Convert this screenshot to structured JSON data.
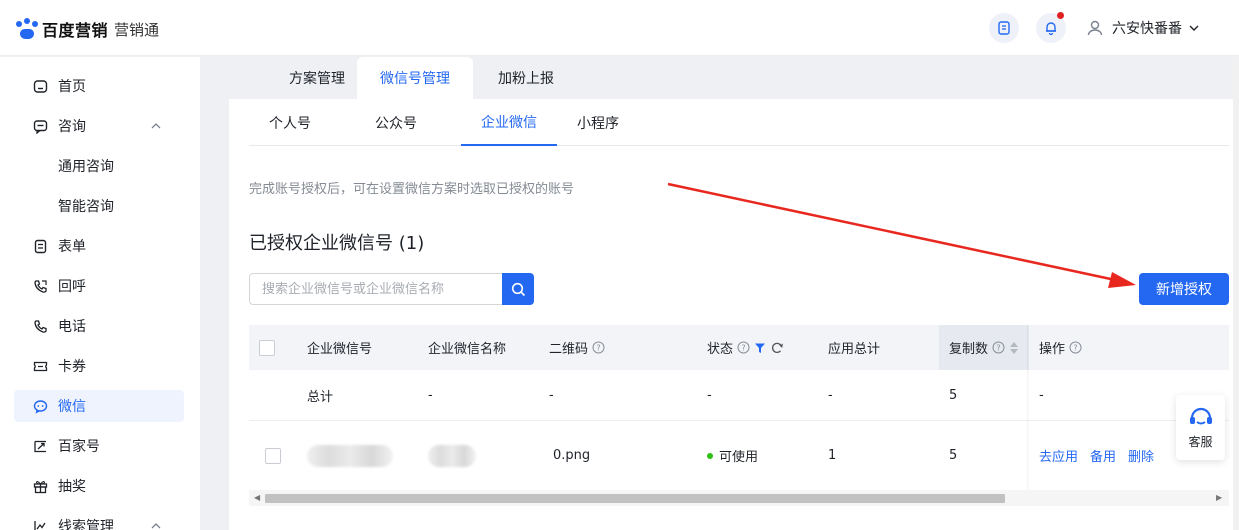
{
  "header": {
    "brand": "百度营销",
    "product": "营销通",
    "user_name": "六安快番番"
  },
  "sidebar": {
    "items": [
      {
        "label": "首页",
        "icon": "home-icon"
      },
      {
        "label": "咨询",
        "icon": "chat-icon",
        "expanded": true
      },
      {
        "label": "通用咨询"
      },
      {
        "label": "智能咨询"
      },
      {
        "label": "表单",
        "icon": "form-icon"
      },
      {
        "label": "回呼",
        "icon": "callback-icon"
      },
      {
        "label": "电话",
        "icon": "phone-icon"
      },
      {
        "label": "卡券",
        "icon": "ticket-icon"
      },
      {
        "label": "微信",
        "icon": "wechat-icon",
        "active": true
      },
      {
        "label": "百家号",
        "icon": "baijiahao-icon"
      },
      {
        "label": "抽奖",
        "icon": "gift-icon"
      },
      {
        "label": "线索管理",
        "icon": "chart-icon",
        "expanded": true
      }
    ]
  },
  "top_tabs": [
    "方案管理",
    "微信号管理",
    "加粉上报"
  ],
  "sub_tabs": [
    "个人号",
    "公众号",
    "企业微信",
    "小程序"
  ],
  "hint": "完成账号授权后，可在设置微信方案时选取已授权的账号",
  "section_title": "已授权企业微信号 (1)",
  "search": {
    "placeholder": "搜索企业微信号或企业微信名称"
  },
  "add_button": "新增授权",
  "table": {
    "columns": [
      "企业微信号",
      "企业微信名称",
      "二维码",
      "状态",
      "应用总计",
      "复制数",
      "操作"
    ],
    "summary_row": {
      "label": "总计",
      "name": "-",
      "qrcode": "-",
      "status": "-",
      "total": "-",
      "copies": "5",
      "ops": "-"
    },
    "rows": [
      {
        "qrcode": "0.png",
        "status": "可使用",
        "total": "1",
        "copies": "5",
        "actions": [
          "去应用",
          "备用",
          "删除"
        ]
      }
    ]
  },
  "service_label": "客服",
  "colors": {
    "primary": "#2468f2",
    "status_ok": "#30bf13",
    "annotation_arrow": "#e8281e"
  }
}
